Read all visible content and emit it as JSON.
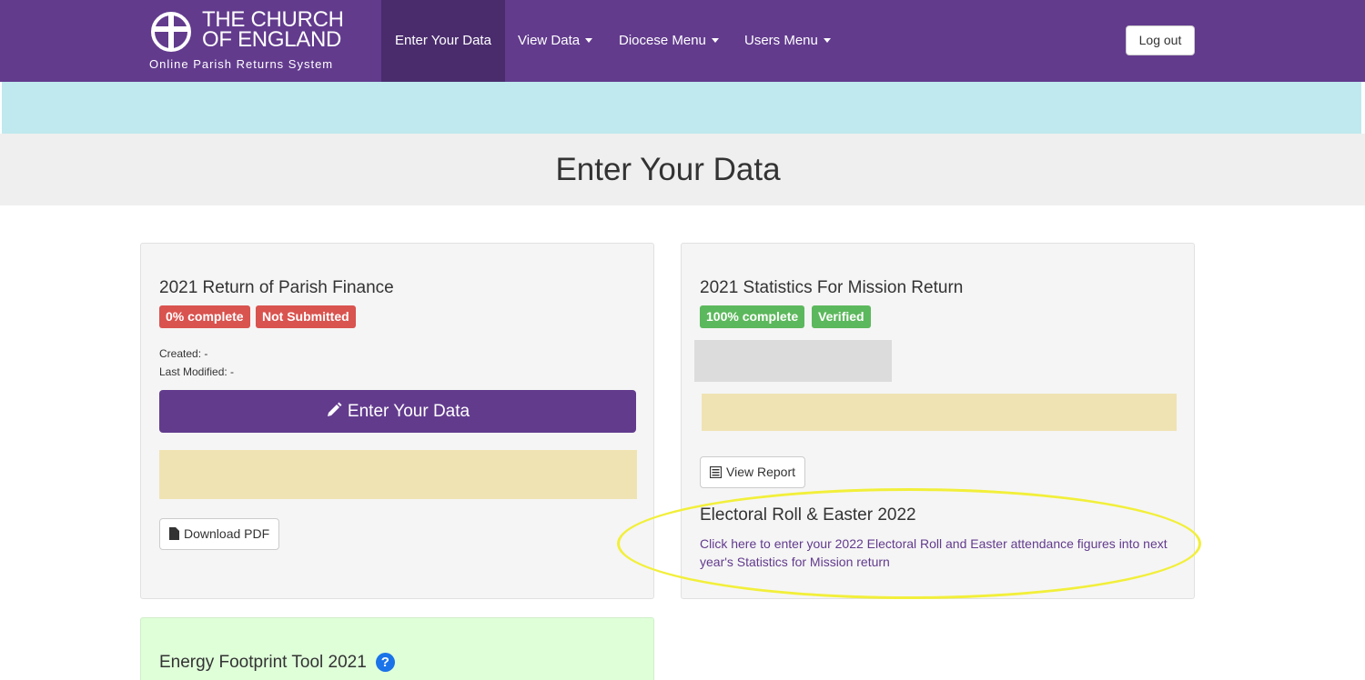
{
  "brand": {
    "line1": "THE CHURCH",
    "line2": "OF ENGLAND",
    "subtitle": "Online Parish Returns System",
    "logo_icon": "church-cross-logo"
  },
  "nav": {
    "items": [
      {
        "label": "Enter Your Data",
        "active": true,
        "dropdown": false
      },
      {
        "label": "View Data",
        "active": false,
        "dropdown": true
      },
      {
        "label": "Diocese Menu",
        "active": false,
        "dropdown": true
      },
      {
        "label": "Users Menu",
        "active": false,
        "dropdown": true
      }
    ],
    "logout_label": "Log out"
  },
  "page": {
    "title": "Enter Your Data"
  },
  "finance_panel": {
    "title": "2021 Return of Parish Finance",
    "badges": [
      "0% complete",
      "Not Submitted"
    ],
    "created": "Created: -",
    "last_modified": "Last Modified: -",
    "enter_button_label": "Enter Your Data",
    "download_button_label": "Download PDF"
  },
  "mission_panel": {
    "title": "2021 Statistics For Mission Return",
    "badges": [
      "100% complete",
      "Verified"
    ],
    "view_report_label": "View Report",
    "electoral_title": "Electoral Roll & Easter 2022",
    "electoral_link": "Click here to enter your 2022 Electoral Roll and Easter attendance figures into next year's Statistics for Mission return"
  },
  "energy_panel": {
    "title": "Energy Footprint Tool 2021",
    "help_label": "?"
  },
  "colors": {
    "nav_purple": "#623b8d",
    "nav_active": "#4a2c6d",
    "badge_red": "#d9534f",
    "badge_green": "#5cb85c",
    "alert_cyan": "#bfe9ee",
    "warning_yellow": "#f0e3b3",
    "highlight_yellow": "#f2ef3a",
    "energy_green": "#dfffd9"
  }
}
